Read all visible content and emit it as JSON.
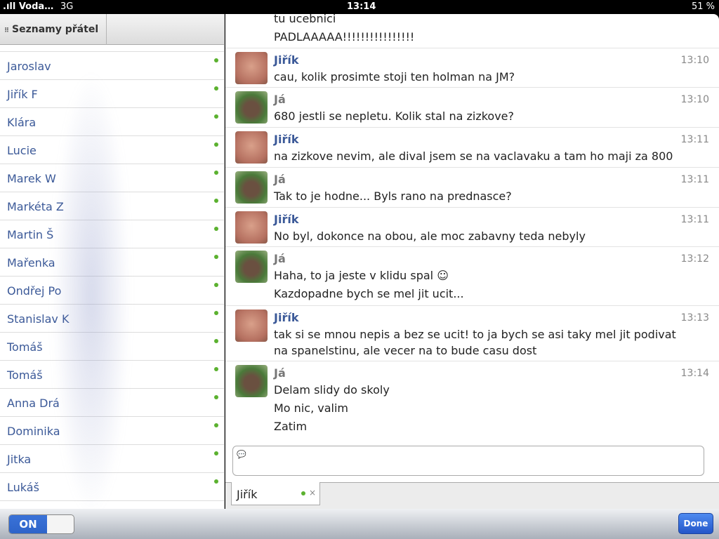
{
  "status": {
    "carrier": ".ıll Voda…",
    "network": "3G",
    "time": "13:14",
    "battery": "51 %"
  },
  "sidebar": {
    "tab_label": "Seznamy přátel",
    "tab_icon": "grid-icon",
    "contacts": [
      "Jaroslav",
      "Jiřík F",
      "Klára",
      "Lucie",
      "Marek W",
      "Markéta Z",
      "Martin Š",
      "Mařenka",
      "Ondřej Po",
      "Stanislav K",
      "Tomáš",
      "Tomáš",
      "Anna Drá",
      "Dominika",
      "Jitka",
      "Lukáš"
    ]
  },
  "chat": {
    "top_lines": [
      "tu ucebnici",
      "PADLAAAAA!!!!!!!!!!!!!!!!"
    ],
    "messages": [
      {
        "sender": "Jiřík",
        "time": "13:10",
        "lines": [
          "cau, kolik prosimte stoji ten holman na JM?"
        ]
      },
      {
        "sender": "Já",
        "time": "13:10",
        "lines": [
          "680 jestli se nepletu. Kolik stal na zizkove?"
        ]
      },
      {
        "sender": "Jiřík",
        "time": "13:11",
        "lines": [
          "na zizkove nevim, ale dival jsem se na vaclavaku a tam ho maji za 800"
        ]
      },
      {
        "sender": "Já",
        "time": "13:11",
        "lines": [
          "Tak to je hodne... Byls rano na prednasce?"
        ]
      },
      {
        "sender": "Jiřík",
        "time": "13:11",
        "lines": [
          "No byl, dokonce na obou, ale moc zabavny teda nebyly"
        ]
      },
      {
        "sender": "Já",
        "time": "13:12",
        "lines": [
          "Haha, to ja jeste v klidu spal ☺",
          "Kazdopadne bych se mel jit ucit..."
        ]
      },
      {
        "sender": "Jiřík",
        "time": "13:13",
        "lines": [
          "tak si se mnou nepis a bez se ucit! to ja bych se asi taky mel jit podivat",
          "na spanelstinu, ale vecer na to bude casu dost"
        ]
      },
      {
        "sender": "Já",
        "time": "13:14",
        "lines": [
          "Delam slidy do skoly",
          "Mo nic, valim",
          "Zatim"
        ]
      }
    ],
    "input_value": "",
    "open_tab": "Jiřík",
    "close_glyph": "×"
  },
  "bottom": {
    "toggle_label": "ON",
    "done_label": "Done"
  }
}
